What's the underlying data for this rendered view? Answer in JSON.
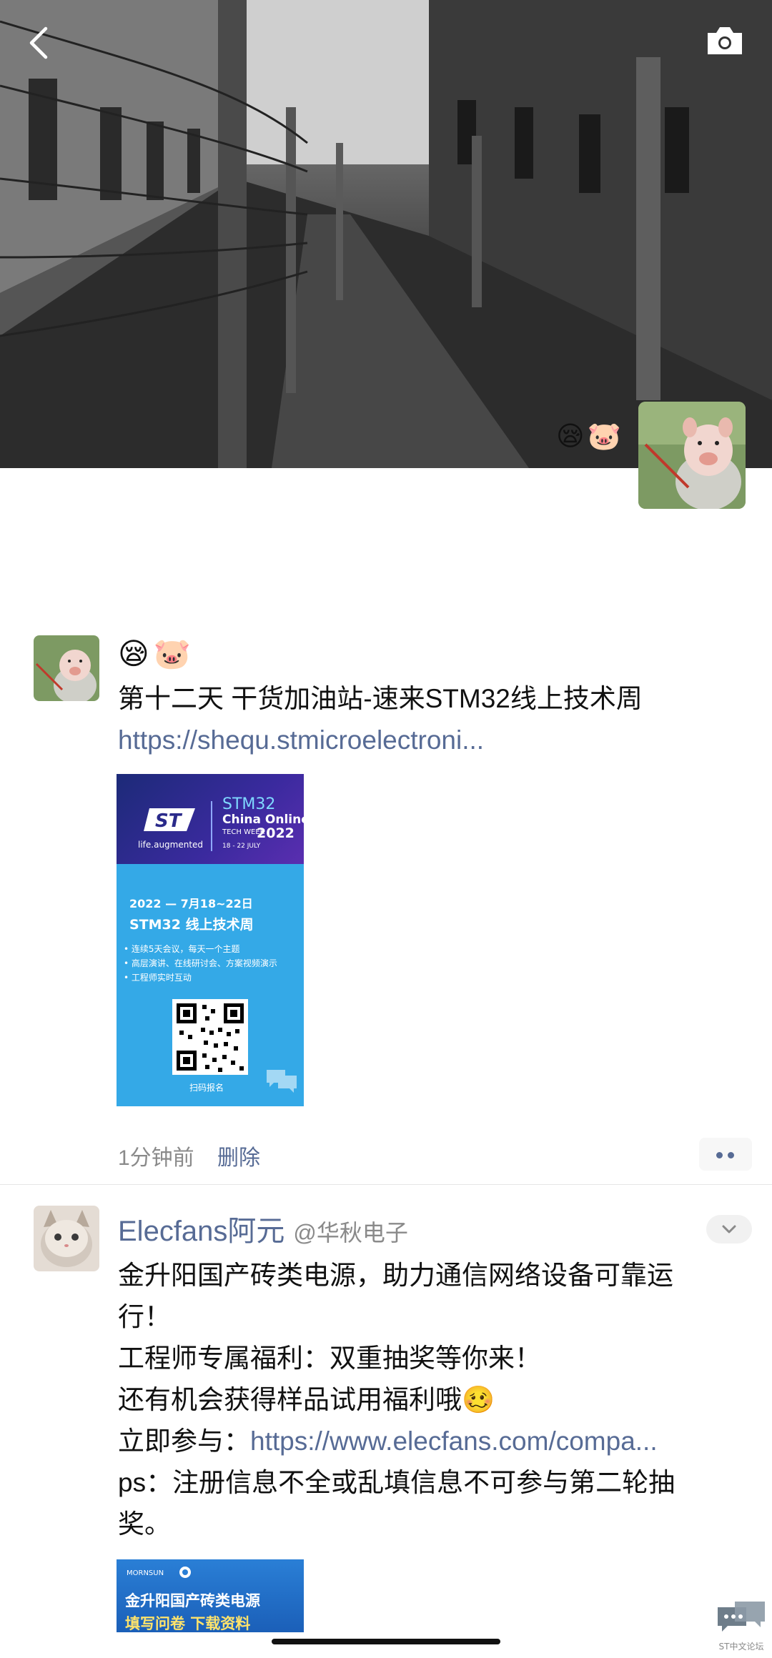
{
  "cover": {
    "emoji": "😪🐷",
    "icons": {
      "back": "chevron-left-icon",
      "camera": "camera-icon"
    }
  },
  "post1": {
    "emoji": "😪🐷",
    "title": "第十二天  干货加油站-速来STM32线上技术周",
    "link": "https://shequ.stmicroelectroni...",
    "poster": {
      "brand_tagline": "life.augmented",
      "event_name": "STM32",
      "event_sub": "China Online",
      "event_week": "TECH WEEK",
      "event_year": "2022",
      "event_dates_short": "18 - 22 JULY",
      "date_line": "2022 — 7月18~22日",
      "headline": "STM32 线上技术周",
      "bullets": [
        "• 连续5天会议，每天一个主题",
        "• 高层演讲、在线研讨会、方案视频演示",
        "• 工程师实时互动"
      ],
      "qr_caption": "扫码报名"
    },
    "time": "1分钟前",
    "delete_label": "删除"
  },
  "post2": {
    "name": "Elecfans阿元",
    "org": "@华秋电子",
    "lines": [
      "金升阳国产砖类电源，助力通信网络设备可靠运",
      "行！",
      "工程师专属福利：双重抽奖等你来！",
      "还有机会获得样品试用福利哦🥴"
    ],
    "join_prefix": "立即参与：",
    "join_link": "https://www.elecfans.com/compa...",
    "ps_lines": [
      "ps：注册信息不全或乱填信息不可参与第二轮抽",
      "奖。"
    ],
    "banner": {
      "brand": "MORNSUN",
      "line1": "金升阳国产砖类电源",
      "line2": "填写问卷  下载资料"
    }
  },
  "watermark": "ST中文论坛"
}
